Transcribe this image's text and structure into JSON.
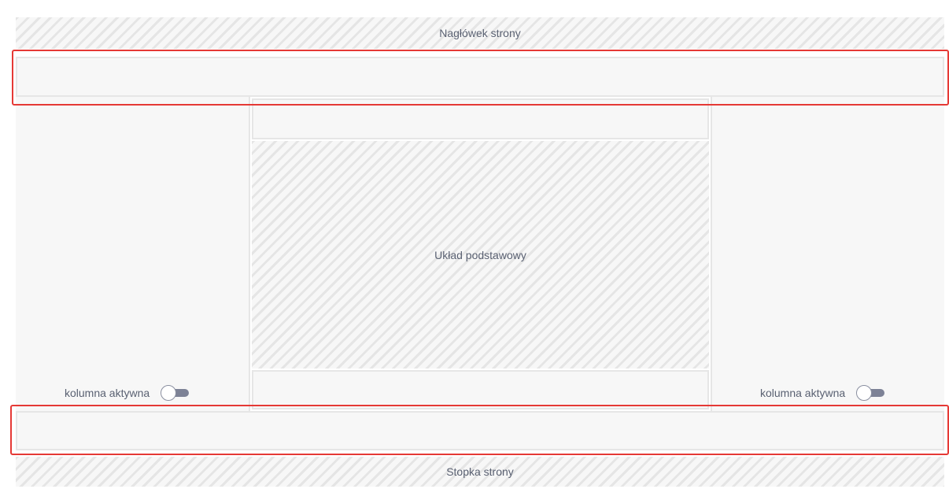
{
  "layout_editor": {
    "header_label": "Nagłówek strony",
    "footer_label": "Stopka strony",
    "main_label": "Układ podstawowy",
    "left_column": {
      "toggle_label": "kolumna aktywna",
      "toggle_on": false
    },
    "right_column": {
      "toggle_label": "kolumna aktywna",
      "toggle_on": false
    }
  },
  "colors": {
    "selection_border": "#e53935",
    "toggle_track": "#7d8296",
    "panel_background": "#f7f7f7",
    "text": "#5a6172"
  },
  "icons": {
    "toggle": "toggle-switch-icon"
  }
}
